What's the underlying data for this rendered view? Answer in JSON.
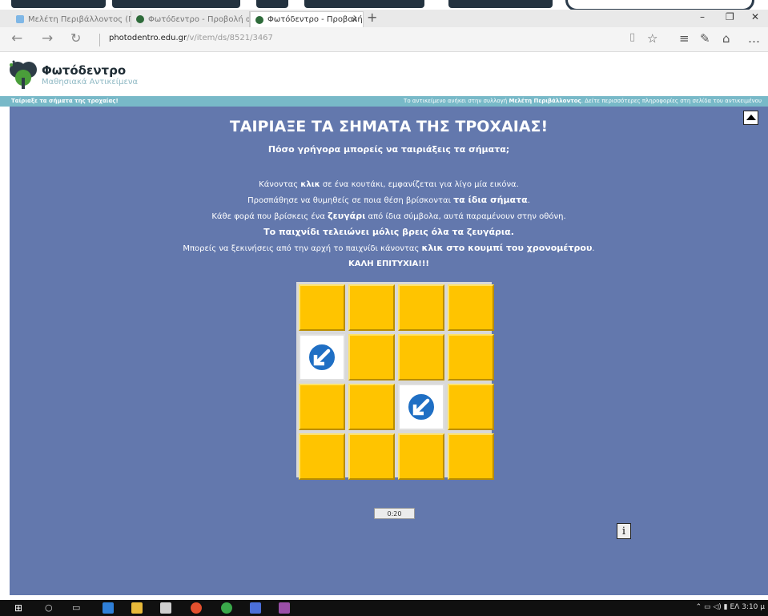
{
  "browser": {
    "tabs": [
      {
        "label": "Μελέτη Περιβάλλοντος (Γ΄ ΄",
        "icon": "page-icon",
        "active": false
      },
      {
        "label": "Φωτόδεντρο - Προβολή αν",
        "icon": "photodentro-favicon",
        "active": false
      },
      {
        "label": "Φωτόδεντρο - Προβολή",
        "icon": "photodentro-favicon",
        "active": true
      }
    ],
    "new_tab": "+",
    "url_host": "photodentro.edu.gr",
    "url_path": "/v/item/ds/8521/3467"
  },
  "site": {
    "title": "Φωτόδεντρο",
    "subtitle": "Μαθησιακά Αντικείμενα"
  },
  "strip": {
    "left": "Ταίριαξε τα σήματα της τροχαίας!",
    "right_prefix": "Το αντικείμενο ανήκει στην συλλογή",
    "right_bold": "Μελέτη Περιβάλλοντος",
    "right_suffix": ". Δείτε περισσότερες πληροφορίες στη σελίδα του αντικειμένου"
  },
  "game": {
    "title": "ΤΑΙΡΙΑΞΕ ΤΑ ΣΗΜΑΤΑ ΤΗΣ ΤΡΟΧΑΙΑΣ!",
    "subtitle": "Πόσο γρήγορα μπορείς να ταιριάξεις τα σήματα;",
    "instructions": {
      "l1_a": "Κάνοντας ",
      "l1_b": "κλικ",
      "l1_c": " σε ένα κουτάκι, εμφανίζεται για λίγο μία εικόνα.",
      "l2_a": "Προσπάθησε να θυμηθείς σε ποια θέση βρίσκονται ",
      "l2_b": "τα ίδια σήματα",
      "l2_c": ".",
      "l3_a": "Κάθε φορά που βρίσκεις ένα ",
      "l3_b": "ζευγάρι",
      "l3_c": " από ίδια σύμβολα, αυτά παραμένουν στην οθόνη.",
      "l4": "Το παιχνίδι τελειώνει μόλις βρεις όλα τα ζευγάρια.",
      "l5_a": "Μπορείς να ξεκινήσεις από την αρχή το παιχνίδι κάνοντας ",
      "l5_b": "κλικ στο κουμπί του χρονομέτρου",
      "l5_c": ".",
      "l6": "ΚΑΛΗ ΕΠΙΤΥΧΙΑ!!!"
    },
    "board": {
      "rows": 4,
      "cols": 4,
      "revealed": [
        {
          "row": 1,
          "col": 0,
          "icon": "keep-left-sign-icon"
        },
        {
          "row": 2,
          "col": 2,
          "icon": "keep-left-sign-icon"
        }
      ]
    },
    "timer": "0:20",
    "info_label": "i"
  },
  "taskbar": {
    "clock": "3:10 μ"
  },
  "colors": {
    "game_bg": "#6378ad",
    "card": "#ffc400",
    "strip": "#78b9c8",
    "sign_blue": "#1f6fc4"
  }
}
